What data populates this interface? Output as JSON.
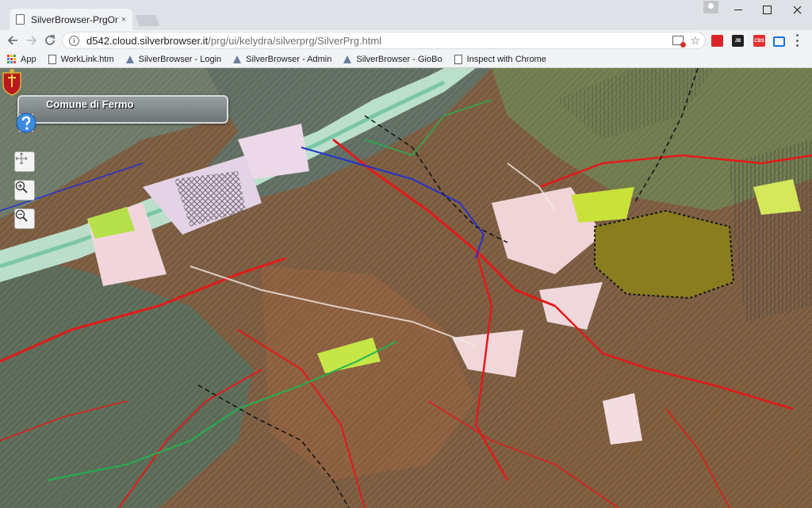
{
  "browser": {
    "tab_title": "SilverBrowser-PrgOnLine",
    "tab_close": "×",
    "url_host": "d542.cloud.silverbrowser.it",
    "url_path": "/prg/ui/kelydra/silverprg/SilverPrg.html",
    "ext_labels": [
      "",
      "JB",
      "CBS",
      ""
    ]
  },
  "bookmarks": [
    {
      "label": "App",
      "icon": "apps-icon"
    },
    {
      "label": "WorkLink.htm",
      "icon": "page-icon"
    },
    {
      "label": "SilverBrowser - Login",
      "icon": "flask-icon"
    },
    {
      "label": "SilverBrowser - Admin",
      "icon": "flask-icon"
    },
    {
      "label": "SilverBrowser - GioBo",
      "icon": "flask-icon"
    },
    {
      "label": "Inspect with Chrome",
      "icon": "page-icon"
    }
  ],
  "app": {
    "municipality": "Comune di Fermo",
    "tools": [
      "info-icon",
      "binoculars-icon",
      "legend-icon",
      "book-icon",
      "print-icon",
      "help-icon"
    ],
    "map_controls": [
      "pan-icon",
      "zoom-in-icon",
      "zoom-out-icon"
    ]
  },
  "colors": {
    "panel": "#7f8587",
    "road_red": "#e41a1a",
    "river_blue": "#2233cc",
    "path_green": "#22b14c",
    "urban_pink": "#f2d5dc",
    "historic_olive": "#8a7d1f"
  }
}
